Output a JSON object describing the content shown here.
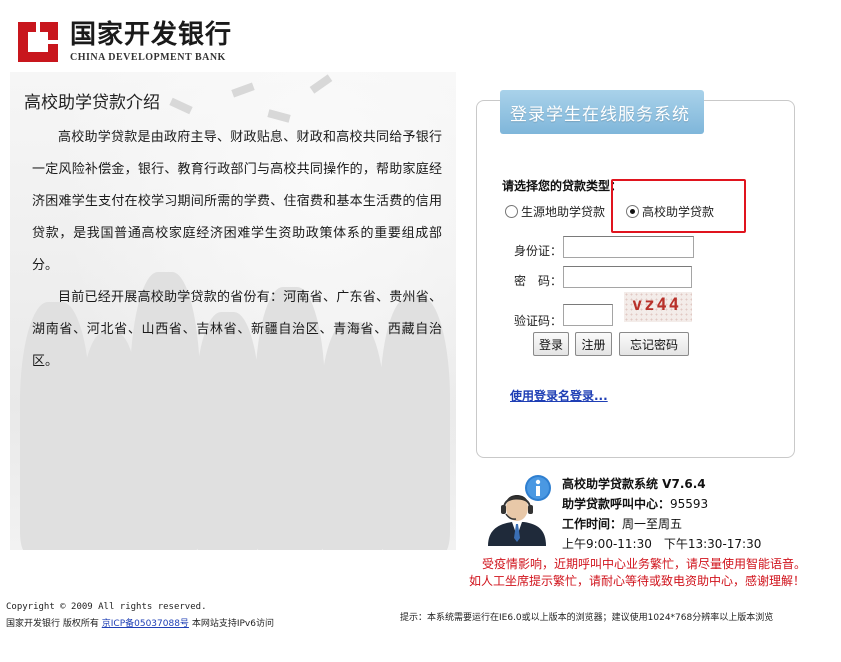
{
  "header": {
    "logo_cn": "国家开发银行",
    "logo_en": "CHINA DEVELOPMENT BANK",
    "brand_color": "#c8161d"
  },
  "intro": {
    "title": "高校助学贷款介绍",
    "paragraph1": "高校助学贷款是由政府主导、财政贴息、财政和高校共同给予银行一定风险补偿金，银行、教育行政部门与高校共同操作的，帮助家庭经济困难学生支付在校学习期间所需的学费、住宿费和基本生活费的信用贷款，是我国普通高校家庭经济困难学生资助政策体系的重要组成部分。",
    "paragraph2": "目前已经开展高校助学贷款的省份有：河南省、广东省、贵州省、湖南省、河北省、山西省、吉林省、新疆自治区、青海省、西藏自治区。"
  },
  "login": {
    "header_title": "登录学生在线服务系统",
    "loan_type_label": "请选择您的贷款类型：",
    "options": [
      {
        "label": "生源地助学贷款",
        "checked": false
      },
      {
        "label": "高校助学贷款",
        "checked": true
      }
    ],
    "id_label": "身份证：",
    "id_value": "",
    "password_label": "密　码：",
    "password_value": "",
    "captcha_label": "验证码：",
    "captcha_value": "",
    "captcha_text": "vz44",
    "login_button": "登录",
    "register_button": "注册",
    "forgot_button": "忘记密码",
    "username_login_link": "使用登录名登录...",
    "highlight_color": "#e0141e"
  },
  "info": {
    "system_name": "高校助学贷款系统 V7.6.4",
    "hotline_label": "助学贷款呼叫中心：",
    "hotline_number": "95593",
    "worktime_label": "工作时间：",
    "worktime_days": "周一至周五",
    "worktime_hours": "上午9:00-11:30　下午13:30-17:30",
    "notice_line1": "受疫情影响，近期呼叫中心业务繁忙，请尽量使用智能语音。",
    "notice_line2": "如人工坐席提示繁忙，请耐心等待或致电资助中心，感谢理解！",
    "notice_color": "#d0121b"
  },
  "footer": {
    "copyright": "Copyright © 2009 All rights reserved.",
    "owner": "国家开发银行 版权所有",
    "icp": "京ICP备05037088号",
    "ipv6": "本网站支持IPv6访问",
    "browser_tip": "提示：本系统需要运行在IE6.0或以上版本的浏览器；建议使用1024*768分辨率以上版本浏览"
  }
}
